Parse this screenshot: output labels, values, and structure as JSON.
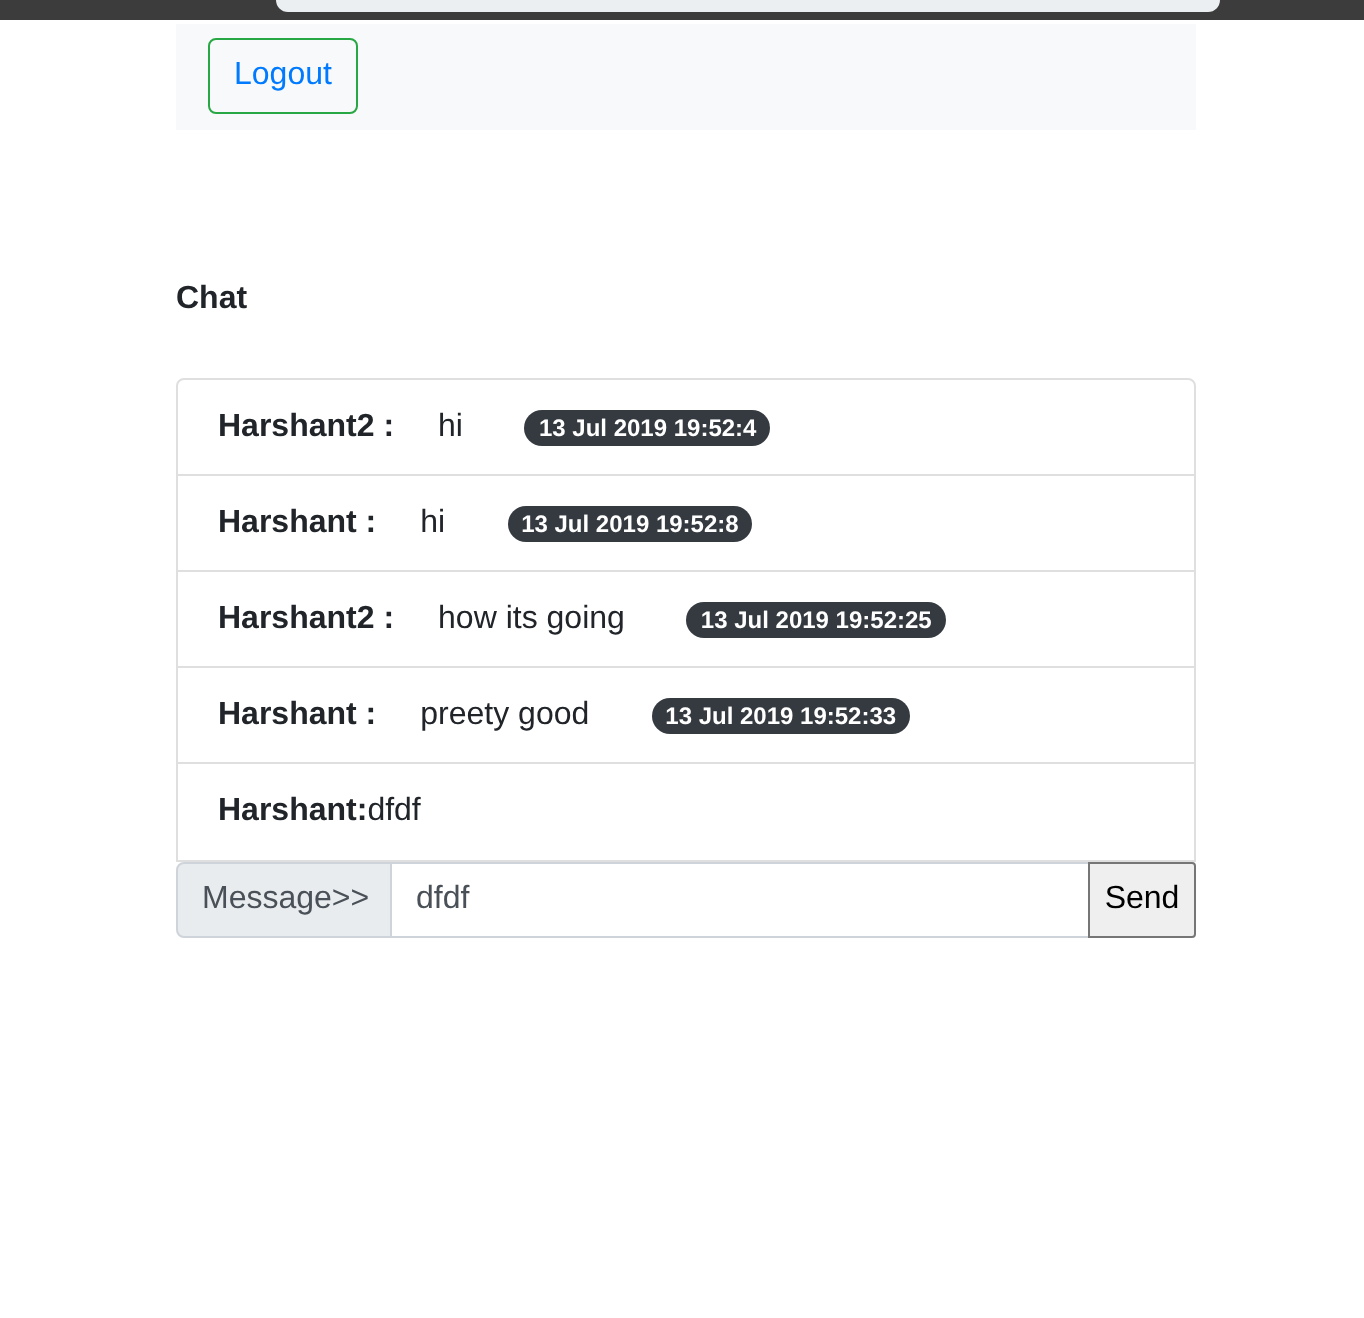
{
  "navbar": {
    "logout_button": "Logout"
  },
  "heading": "Chat",
  "messages": [
    {
      "kind": "message",
      "sender": "Harshant2 :",
      "text": "hi",
      "time": "13 Jul 2019 19:52:4"
    },
    {
      "kind": "message",
      "sender": "Harshant :",
      "text": "hi",
      "time": "13 Jul 2019 19:52:8"
    },
    {
      "kind": "message",
      "sender": "Harshant2 :",
      "text": "how its going",
      "time": "13 Jul 2019 19:52:25"
    },
    {
      "kind": "message",
      "sender": "Harshant :",
      "text": "preety good",
      "time": "13 Jul 2019 19:52:33"
    },
    {
      "kind": "draft",
      "text": "**Harshant:**dfdf"
    }
  ],
  "composer": {
    "label": "Message>>",
    "value": "dfdf",
    "send_button": "Send"
  }
}
